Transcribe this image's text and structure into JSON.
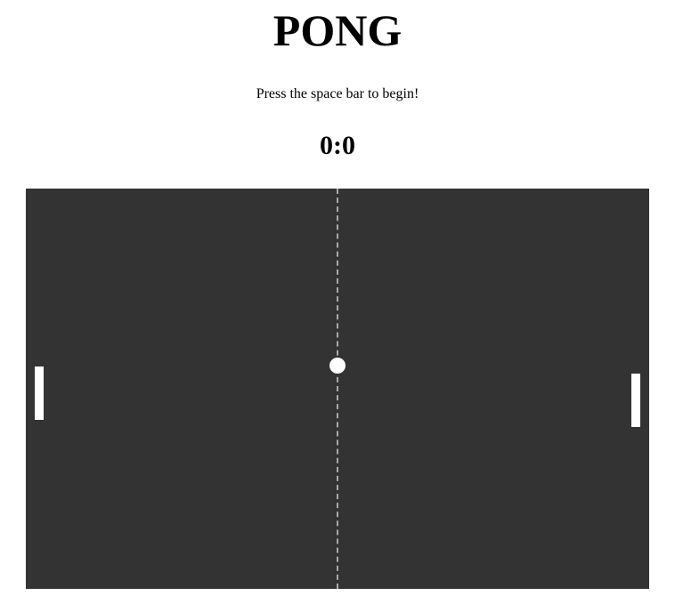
{
  "game": {
    "title": "PONG",
    "instructions": "Press the space bar to begin!",
    "score": "0:0"
  },
  "colors": {
    "court_background": "#333333",
    "net": "#aaaaaa",
    "paddle": "#ffffff",
    "ball": "#ffffff"
  }
}
